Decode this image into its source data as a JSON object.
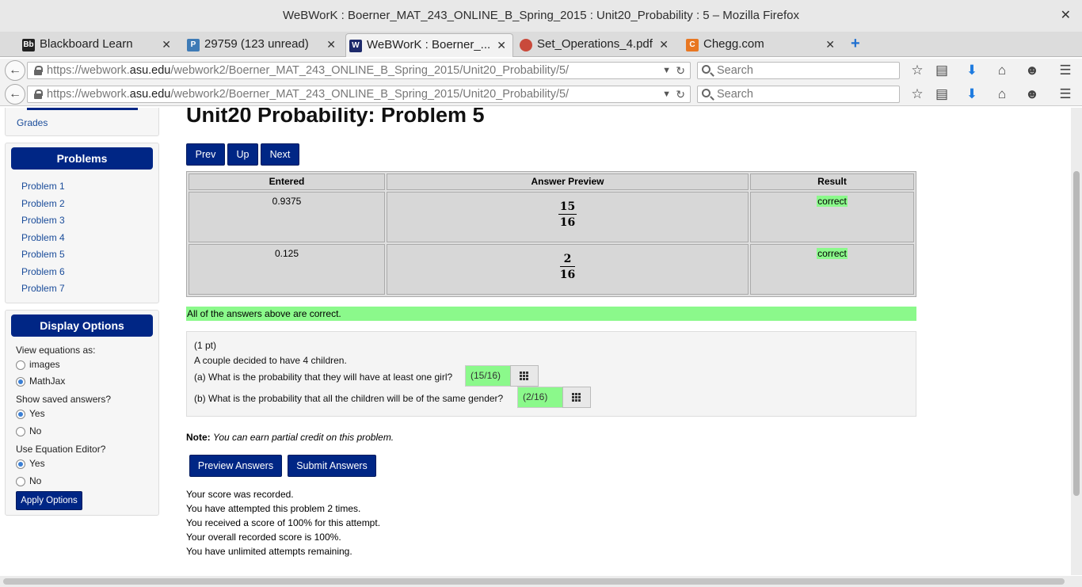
{
  "window": {
    "title": "WeBWorK : Boerner_MAT_243_ONLINE_B_Spring_2015 : Unit20_Probability : 5 – Mozilla Firefox"
  },
  "tabs": [
    {
      "label": "Blackboard Learn",
      "favicon": "Bb"
    },
    {
      "label": "29759 (123 unread)",
      "favicon": "P"
    },
    {
      "label": "WeBWorK : Boerner_...",
      "favicon": "W"
    },
    {
      "label": "Set_Operations_4.pdf",
      "favicon": ""
    },
    {
      "label": "Chegg.com",
      "favicon": "C"
    }
  ],
  "url": {
    "prefix": "https://webwork.",
    "domain": "asu.edu",
    "path": "/webwork2/Boerner_MAT_243_ONLINE_B_Spring_2015/Unit20_Probability/5/"
  },
  "search": {
    "placeholder": "Search"
  },
  "page": {
    "heading": "Unit20 Probability: Problem 5",
    "grades_link": "Grades",
    "nav": {
      "prev": "Prev",
      "up": "Up",
      "next": "Next"
    }
  },
  "sidebar": {
    "problems_title": "Problems",
    "problems": [
      "Problem 1",
      "Problem 2",
      "Problem 3",
      "Problem 4",
      "Problem 5",
      "Problem 6",
      "Problem 7"
    ],
    "display_title": "Display Options",
    "view_eq_label": "View equations as:",
    "view_eq_options": [
      "images",
      "MathJax"
    ],
    "saved_label": "Show saved answers?",
    "editor_label": "Use Equation Editor?",
    "yes": "Yes",
    "no": "No",
    "apply": "Apply Options"
  },
  "results": {
    "headers": [
      "Entered",
      "Answer Preview",
      "Result"
    ],
    "rows": [
      {
        "entered": "0.9375",
        "num": "15",
        "den": "16",
        "result": "correct"
      },
      {
        "entered": "0.125",
        "num": "2",
        "den": "16",
        "result": "correct"
      }
    ],
    "summary": "All of the answers above are correct."
  },
  "problem": {
    "points": "(1 pt)",
    "intro": "A couple decided to have 4 children.",
    "part_a": "(a)   What is the probability that they will have at least one girl?",
    "answer_a": "(15/16)",
    "part_b": "(b)   What is the probability that all the children will be of the same gender?",
    "answer_b": "(2/16)"
  },
  "note": {
    "label": "Note:",
    "text": "You can earn partial credit on this problem."
  },
  "buttons": {
    "preview": "Preview Answers",
    "submit": "Submit Answers"
  },
  "status": [
    "Your score was recorded.",
    "You have attempted this problem 2 times.",
    "You received a score of 100% for this attempt.",
    "Your overall recorded score is 100%.",
    "You have unlimited attempts remaining."
  ],
  "colors": {
    "accent": "#002685",
    "correct": "#8bf98b"
  }
}
